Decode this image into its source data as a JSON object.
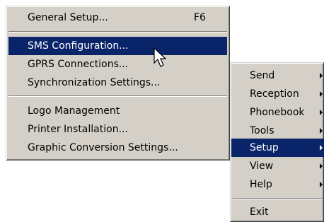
{
  "setup_menu": {
    "items": [
      {
        "label": "General Setup...",
        "shortcut": "F6"
      },
      {
        "label": "SMS Configuration..."
      },
      {
        "label": "GPRS Connections..."
      },
      {
        "label": "Synchronization Settings..."
      },
      {
        "label": "Logo Management"
      },
      {
        "label": "Printer Installation..."
      },
      {
        "label": "Graphic Conversion Settings..."
      }
    ]
  },
  "main_menu": {
    "items": [
      {
        "label": "Send"
      },
      {
        "label": "Reception"
      },
      {
        "label": "Phonebook"
      },
      {
        "label": "Tools"
      },
      {
        "label": "Setup"
      },
      {
        "label": "View"
      },
      {
        "label": "Help"
      },
      {
        "label": "Exit"
      }
    ]
  },
  "colors": {
    "menu_bg": "#d4d0c8",
    "highlight": "#0a246a",
    "highlight_text": "#ffffff"
  },
  "icons": {
    "cursor": "arrow-cursor-icon",
    "submenu": "submenu-arrow-icon"
  }
}
